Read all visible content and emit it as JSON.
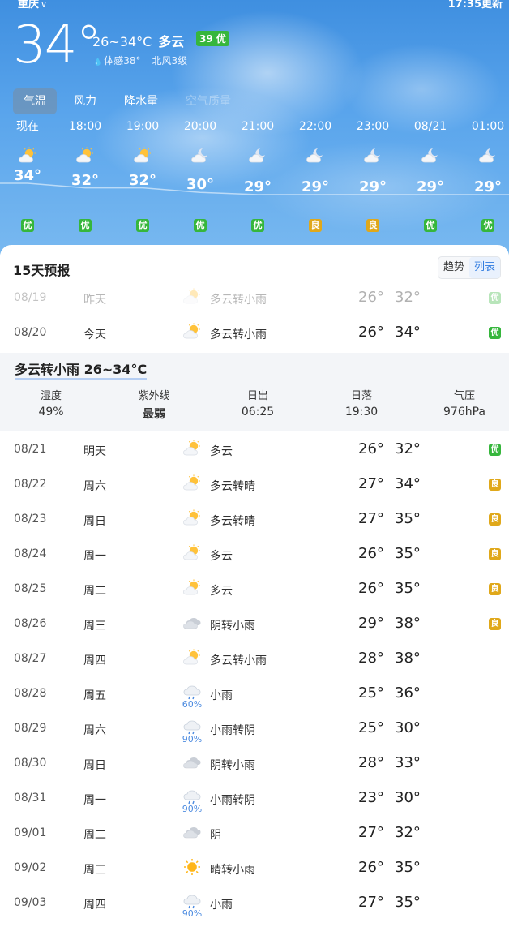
{
  "header": {
    "city": "重庆",
    "updated": "17:35更新",
    "current_temp": "34°",
    "temp_range": "26~34°C",
    "condition": "多云",
    "aqi_badge": "39 优",
    "feels_like": "体感38°",
    "wind": "北风3级"
  },
  "tabs": [
    {
      "label": "气温",
      "active": true
    },
    {
      "label": "风力",
      "active": false
    },
    {
      "label": "降水量",
      "active": false
    },
    {
      "label": "空气质量",
      "active": false
    }
  ],
  "hourly": [
    {
      "time": "现在",
      "temp": 34,
      "temp_label": "34°",
      "icon": "partly-cloudy-day-icon",
      "aqi": "优",
      "aqi_level": "good"
    },
    {
      "time": "18:00",
      "temp": 32,
      "temp_label": "32°",
      "icon": "partly-cloudy-day-icon",
      "aqi": "优",
      "aqi_level": "good"
    },
    {
      "time": "19:00",
      "temp": 32,
      "temp_label": "32°",
      "icon": "partly-cloudy-day-icon",
      "aqi": "优",
      "aqi_level": "good"
    },
    {
      "time": "20:00",
      "temp": 30,
      "temp_label": "30°",
      "icon": "partly-cloudy-night-icon",
      "aqi": "优",
      "aqi_level": "good"
    },
    {
      "time": "21:00",
      "temp": 29,
      "temp_label": "29°",
      "icon": "partly-cloudy-night-icon",
      "aqi": "优",
      "aqi_level": "good"
    },
    {
      "time": "22:00",
      "temp": 29,
      "temp_label": "29°",
      "icon": "partly-cloudy-night-icon",
      "aqi": "良",
      "aqi_level": "moderate"
    },
    {
      "time": "23:00",
      "temp": 29,
      "temp_label": "29°",
      "icon": "partly-cloudy-night-icon",
      "aqi": "良",
      "aqi_level": "moderate"
    },
    {
      "time": "08/21",
      "temp": 29,
      "temp_label": "29°",
      "icon": "partly-cloudy-night-icon",
      "aqi": "优",
      "aqi_level": "good"
    },
    {
      "time": "01:00",
      "temp": 29,
      "temp_label": "29°",
      "icon": "partly-cloudy-night-icon",
      "aqi": "优",
      "aqi_level": "good"
    }
  ],
  "forecast": {
    "title": "15天预报",
    "toggle": {
      "trend": "趋势",
      "list": "列表",
      "selected": "list"
    },
    "detail": {
      "title": "多云转小雨 26~34°C",
      "metrics": [
        {
          "label": "湿度",
          "value": "49%"
        },
        {
          "label": "紫外线",
          "value": "最弱"
        },
        {
          "label": "日出",
          "value": "06:25"
        },
        {
          "label": "日落",
          "value": "19:30"
        },
        {
          "label": "气压",
          "value": "976hPa"
        }
      ]
    },
    "days": [
      {
        "date": "08/19",
        "day": "昨天",
        "icon": "partly-cloudy-day-icon",
        "desc": "多云转小雨",
        "low": "26°",
        "high": "32°",
        "aqi": "优",
        "aqi_level": "good",
        "past": true
      },
      {
        "date": "08/20",
        "day": "今天",
        "icon": "partly-cloudy-day-icon",
        "desc": "多云转小雨",
        "low": "26°",
        "high": "34°",
        "aqi": "优",
        "aqi_level": "good"
      },
      {
        "date": "08/21",
        "day": "明天",
        "icon": "partly-cloudy-day-icon",
        "desc": "多云",
        "low": "26°",
        "high": "32°",
        "aqi": "优",
        "aqi_level": "good"
      },
      {
        "date": "08/22",
        "day": "周六",
        "icon": "partly-cloudy-day-icon",
        "desc": "多云转晴",
        "low": "27°",
        "high": "34°",
        "aqi": "良",
        "aqi_level": "moderate"
      },
      {
        "date": "08/23",
        "day": "周日",
        "icon": "partly-cloudy-day-icon",
        "desc": "多云转晴",
        "low": "27°",
        "high": "35°",
        "aqi": "良",
        "aqi_level": "moderate"
      },
      {
        "date": "08/24",
        "day": "周一",
        "icon": "partly-cloudy-day-icon",
        "desc": "多云",
        "low": "26°",
        "high": "35°",
        "aqi": "良",
        "aqi_level": "moderate"
      },
      {
        "date": "08/25",
        "day": "周二",
        "icon": "partly-cloudy-day-icon",
        "desc": "多云",
        "low": "26°",
        "high": "35°",
        "aqi": "良",
        "aqi_level": "moderate"
      },
      {
        "date": "08/26",
        "day": "周三",
        "icon": "overcast-icon",
        "desc": "阴转小雨",
        "low": "29°",
        "high": "38°",
        "aqi": "良",
        "aqi_level": "moderate"
      },
      {
        "date": "08/27",
        "day": "周四",
        "icon": "partly-cloudy-day-icon",
        "desc": "多云转小雨",
        "low": "28°",
        "high": "38°"
      },
      {
        "date": "08/28",
        "day": "周五",
        "icon": "light-rain-icon",
        "pop": "60%",
        "desc": "小雨",
        "low": "25°",
        "high": "36°"
      },
      {
        "date": "08/29",
        "day": "周六",
        "icon": "light-rain-icon",
        "pop": "90%",
        "desc": "小雨转阴",
        "low": "25°",
        "high": "30°"
      },
      {
        "date": "08/30",
        "day": "周日",
        "icon": "overcast-icon",
        "desc": "阴转小雨",
        "low": "28°",
        "high": "33°"
      },
      {
        "date": "08/31",
        "day": "周一",
        "icon": "light-rain-icon",
        "pop": "90%",
        "desc": "小雨转阴",
        "low": "23°",
        "high": "30°"
      },
      {
        "date": "09/01",
        "day": "周二",
        "icon": "overcast-icon",
        "desc": "阴",
        "low": "27°",
        "high": "32°"
      },
      {
        "date": "09/02",
        "day": "周三",
        "icon": "sunny-icon",
        "desc": "晴转小雨",
        "low": "26°",
        "high": "35°"
      },
      {
        "date": "09/03",
        "day": "周四",
        "icon": "light-rain-icon",
        "pop": "90%",
        "desc": "小雨",
        "low": "27°",
        "high": "35°"
      }
    ]
  },
  "colors": {
    "aqi_good": "#36b63c",
    "aqi_moderate": "#e0a81a",
    "accent": "#2f7be0"
  }
}
